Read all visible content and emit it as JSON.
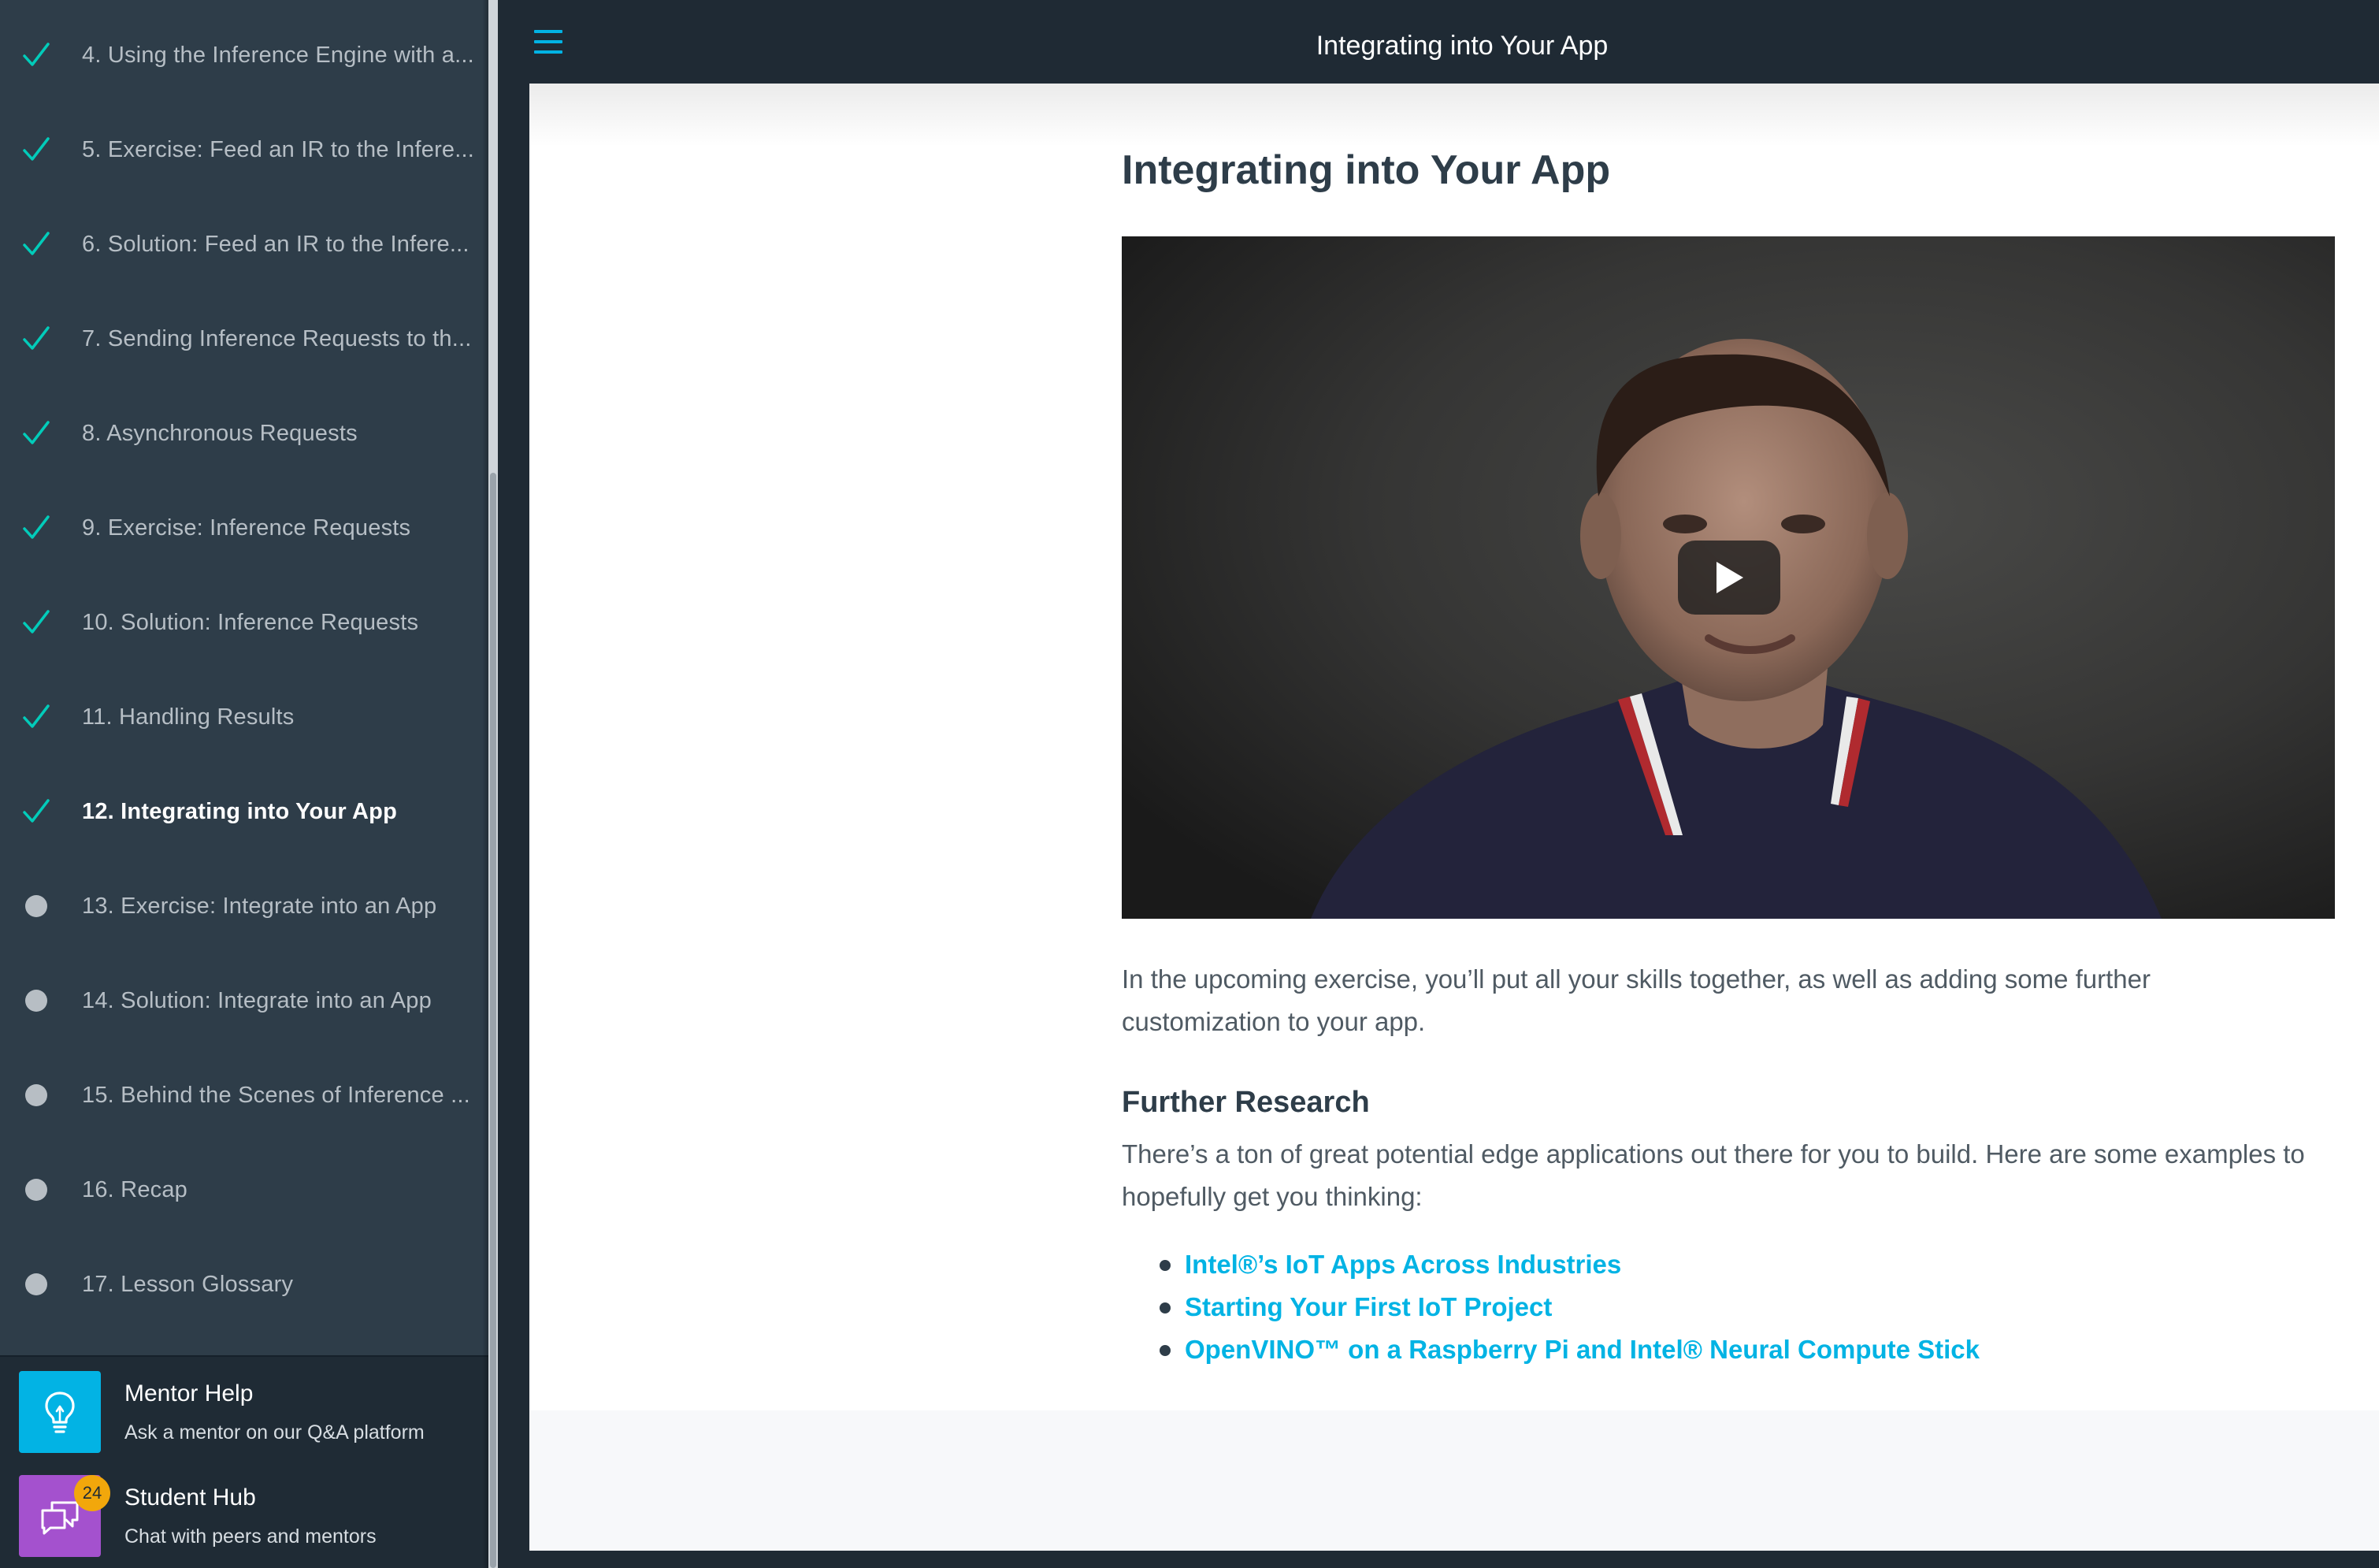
{
  "sidebar": {
    "lessons": [
      {
        "label": "4. Using the Inference Engine with a...",
        "status": "complete"
      },
      {
        "label": "5. Exercise: Feed an IR to the Infere...",
        "status": "complete"
      },
      {
        "label": "6. Solution: Feed an IR to the Infere...",
        "status": "complete"
      },
      {
        "label": "7. Sending Inference Requests to th...",
        "status": "complete"
      },
      {
        "label": "8. Asynchronous Requests",
        "status": "complete"
      },
      {
        "label": "9. Exercise: Inference Requests",
        "status": "complete"
      },
      {
        "label": "10. Solution: Inference Requests",
        "status": "complete"
      },
      {
        "label": "11. Handling Results",
        "status": "complete"
      },
      {
        "label": "12. Integrating into Your App",
        "status": "current"
      },
      {
        "label": "13. Exercise: Integrate into an App",
        "status": "incomplete"
      },
      {
        "label": "14. Solution: Integrate into an App",
        "status": "incomplete"
      },
      {
        "label": "15. Behind the Scenes of Inference ...",
        "status": "incomplete"
      },
      {
        "label": "16. Recap",
        "status": "incomplete"
      },
      {
        "label": "17. Lesson Glossary",
        "status": "incomplete"
      }
    ],
    "mentor_help": {
      "title": "Mentor Help",
      "subtitle": "Ask a mentor on our Q&A platform",
      "icon": "lightbulb-icon",
      "color": "#02b3e4"
    },
    "student_hub": {
      "title": "Student Hub",
      "subtitle": "Chat with peers and mentors",
      "icon": "chat-bubbles-icon",
      "color": "#a451ce",
      "badge": "24"
    }
  },
  "topbar": {
    "title": "Integrating into Your App",
    "menu_icon": "hamburger-menu-icon"
  },
  "main": {
    "title": "Integrating into Your App",
    "video": {
      "play_icon": "play-icon"
    },
    "intro": "In the upcoming exercise, you’ll put all your skills together, as well as adding some further customization to your app.",
    "further_research": {
      "heading": "Further Research",
      "text": "There’s a ton of great potential edge applications out there for you to build. Here are some examples to hopefully get you thinking:",
      "links": [
        "Intel®’s IoT Apps Across Industries",
        "Starting Your First IoT Project",
        "OpenVINO™  on a Raspberry Pi and Intel® Neural Compute Stick"
      ]
    }
  },
  "colors": {
    "accent": "#02b3e4",
    "check": "#02ccba",
    "sidebar_bg": "#2e3d49",
    "topbar_bg": "#1f2a34",
    "badge": "#f2a70b"
  }
}
